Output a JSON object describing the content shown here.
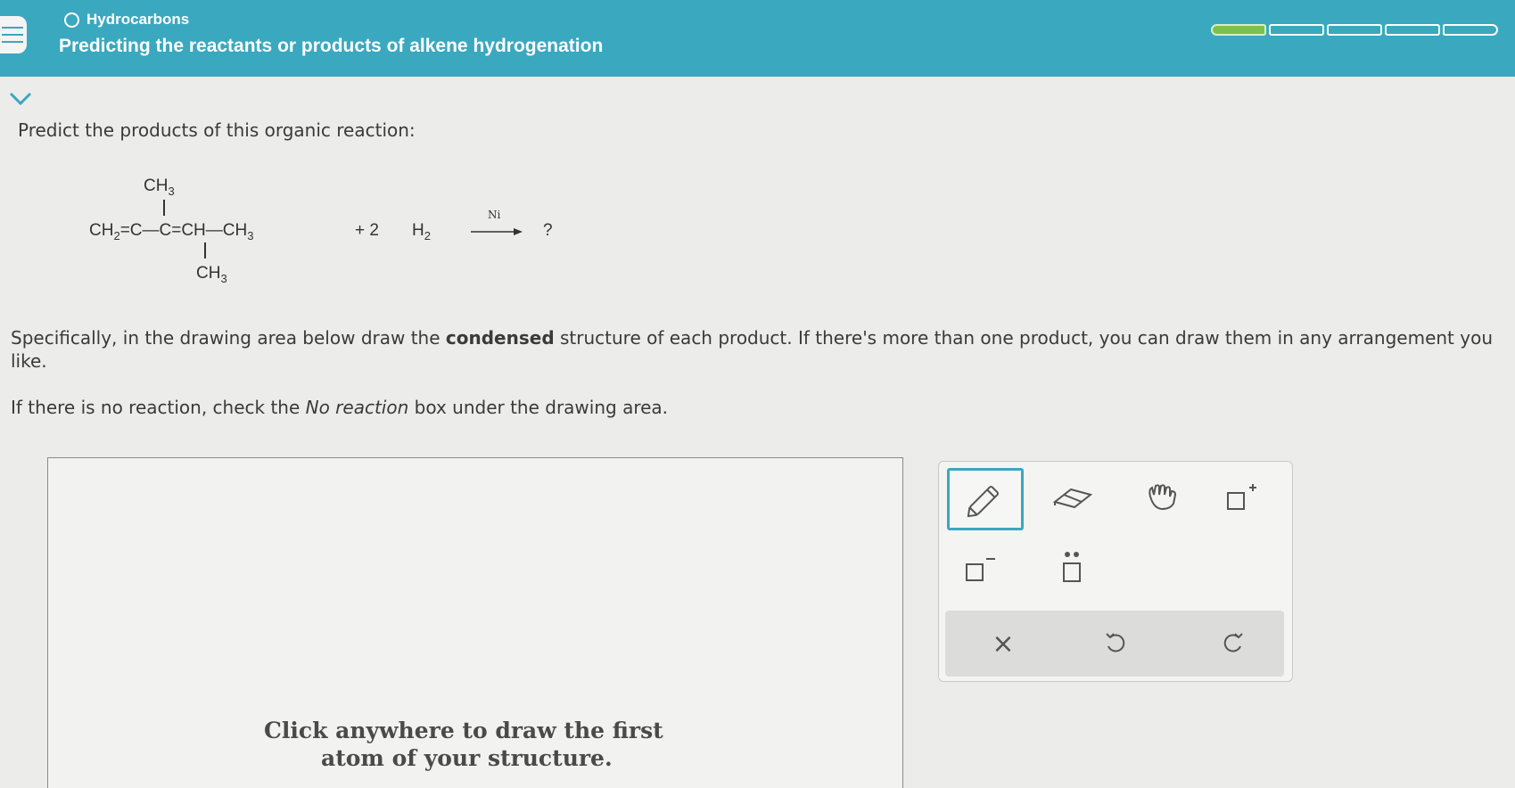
{
  "header": {
    "topic": "Hydrocarbons",
    "title": "Predicting the reactants or products of alkene hydrogenation",
    "progress": {
      "total_segments": 5,
      "filled_segments": 1
    }
  },
  "question": {
    "prompt": "Predict the products of this organic reaction:",
    "reaction": {
      "ch3_top": "CH",
      "ch3_top_sub": "3",
      "ch2": "CH",
      "ch2_sub": "2",
      "eq1": "=C—C=CH—CH",
      "ch3_end_sub": "3",
      "plus": "+ 2",
      "h2": "H",
      "h2_sub": "2",
      "catalyst": "Ni",
      "product": "?",
      "ch3_bottom": "CH",
      "ch3_bottom_sub": "3"
    },
    "spec_part1": "Specifically, in the drawing area below draw the ",
    "spec_bold": "condensed",
    "spec_part2": " structure of each product. If there's more than one product, you can draw them in any arrangement you like.",
    "no_reaction_part1": "If there is no reaction, check the ",
    "no_reaction_italic": "No reaction",
    "no_reaction_part2": " box under the drawing area."
  },
  "drawing_area": {
    "hint_line1": "Click anywhere to draw the first",
    "hint_line2": "atom of your structure."
  },
  "toolbar": {
    "tools": [
      "pencil-icon",
      "eraser-icon",
      "hand-icon",
      "positive-charge-icon",
      "negative-charge-icon",
      "lone-pair-icon"
    ],
    "actions": [
      "clear-icon",
      "undo-icon",
      "redo-icon"
    ],
    "clear_glyph": "×"
  },
  "colors": {
    "header": "#3aa8bf",
    "progress_fill": "#7bc24a",
    "selected_tool": "#3aa8bf"
  }
}
